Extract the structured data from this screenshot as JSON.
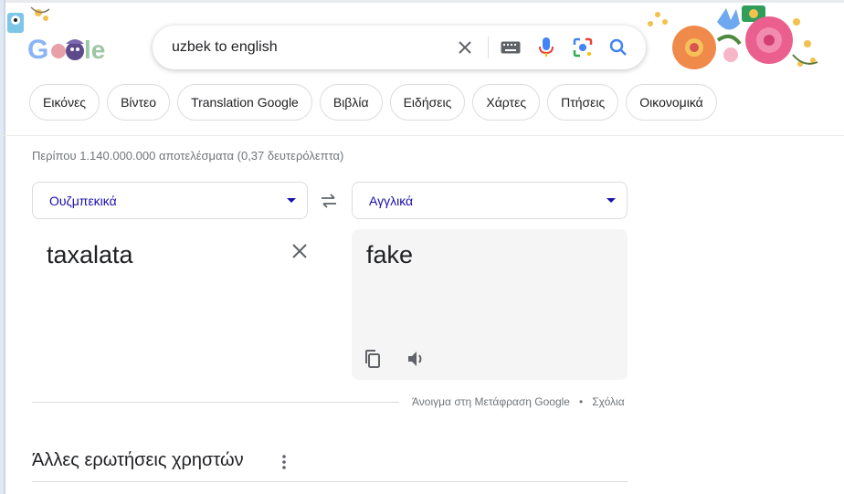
{
  "search": {
    "query": "uzbek to english",
    "icons": [
      "clear-icon",
      "keyboard-icon",
      "mic-icon",
      "lens-icon",
      "search-icon"
    ]
  },
  "chips": [
    "Εικόνες",
    "Βίντεο",
    "Translation Google",
    "Βιβλία",
    "Ειδήσεις",
    "Χάρτες",
    "Πτήσεις",
    "Οικονομικά"
  ],
  "result_stats": "Περίπου 1.140.000.000 αποτελέσματα (0,37 δευτερόλεπτα)",
  "translate": {
    "source_lang": "Ουζμπεκικά",
    "target_lang": "Αγγλικά",
    "source_text": "taxalata",
    "target_text": "fake",
    "open_link": "Άνοιγμα στη Μετάφραση Google",
    "separator": "•",
    "feedback_link": "Σχόλια"
  },
  "paa": {
    "title": "Άλλες ερωτήσεις χρηστών"
  },
  "colors": {
    "accent_blue": "#1a73e8",
    "link_blue": "#1a0dab",
    "text_gray": "#70757a"
  }
}
